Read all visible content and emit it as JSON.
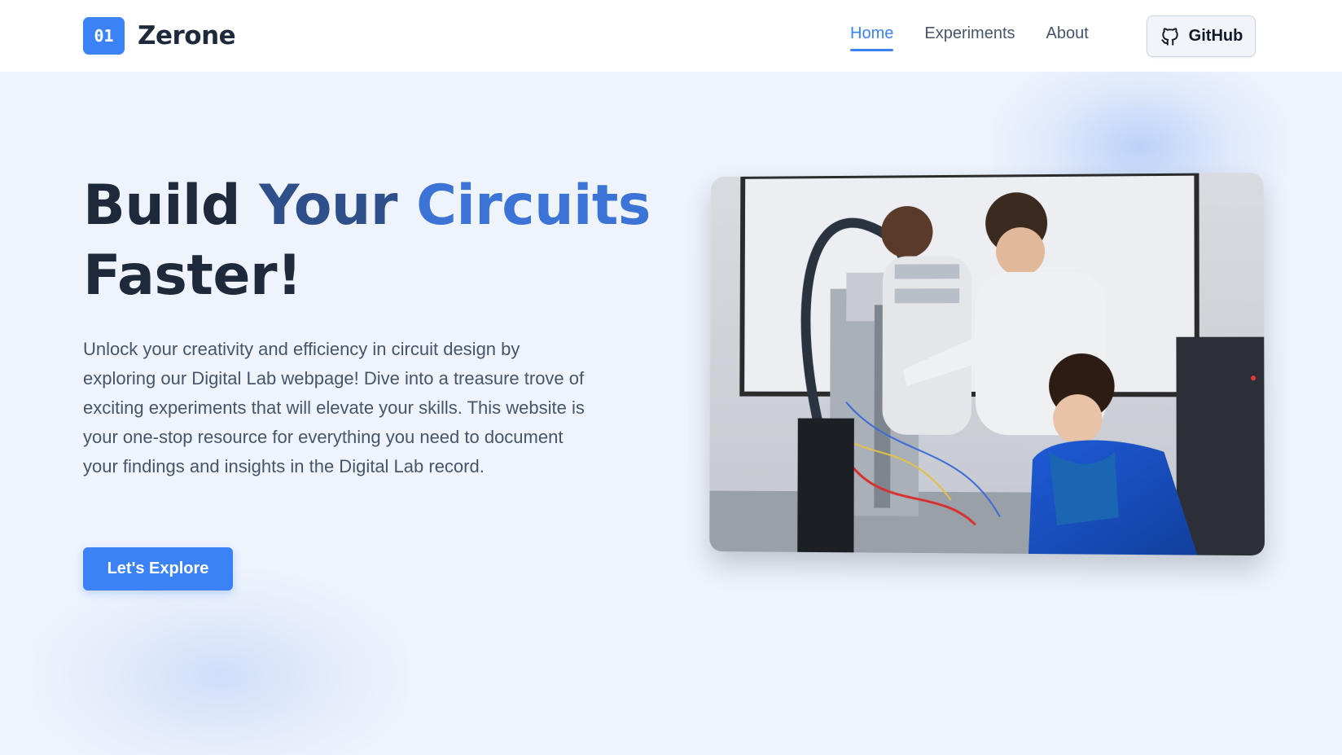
{
  "brand": {
    "logo_mark": "01",
    "name": "Zerone",
    "color": "#3b82f6"
  },
  "nav": {
    "items": [
      {
        "label": "Home",
        "active": true
      },
      {
        "label": "Experiments",
        "active": false
      },
      {
        "label": "About",
        "active": false
      }
    ],
    "github_label": "GitHub",
    "github_icon": "github-icon"
  },
  "hero": {
    "title_line1_part1": "Build ",
    "title_line1_part2": "Your ",
    "title_line1_part3": "Circuits",
    "title_line2": "Faster!",
    "description": "Unlock your creativity and efficiency in circuit design by exploring our Digital Lab webpage! Dive into a treasure trove of exciting experiments that will elevate your skills. This website is your one-stop resource for everything you need to document your findings and insights in the Digital Lab record.",
    "cta_label": "Let's Explore",
    "image_subject": "students-working-with-lab-equipment"
  },
  "colors": {
    "accent": "#3b82f6",
    "title_dark": "#1e293b",
    "title_mid": "#2f4f8a",
    "title_blue": "#3b74d6",
    "background": "#eef3fc"
  }
}
